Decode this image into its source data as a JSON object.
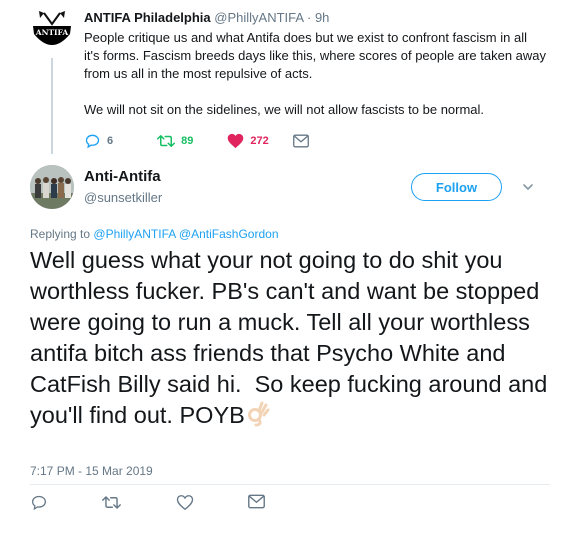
{
  "parent_tweet": {
    "author_name": "ANTIFA Philadelphia",
    "handle": "@PhillyANTIFA",
    "separator": "·",
    "time": "9h",
    "avatar_label": "ANTIFA",
    "paragraphs": [
      "People critique us and what Antifa does but we exist to confront fascism in all it's forms. Fascism breeds days like this, where scores of people are taken away from us all in the most repulsive of acts.",
      "We will not sit on the sidelines, we will not allow fascists to be normal."
    ],
    "replies": "6",
    "retweets": "89",
    "likes": "272"
  },
  "main_tweet": {
    "author_name": "Anti-Antifa",
    "handle": "@sunsetkiller",
    "follow_label": "Follow",
    "replying_prefix": "Replying to",
    "replying_to": "@PhillyANTIFA @AntiFashGordon",
    "text": "Well guess what your not going to do shit you worthless fucker. PB's can't and want be stopped were going to run a muck. Tell all your worthless antifa bitch ass friends that Psycho White and CatFish Billy said hi.  So keep fucking around and you'll find out. POYB",
    "timestamp": "7:17 PM - 15 Mar 2019"
  },
  "colors": {
    "accent": "#1da1f2",
    "retweet": "#17bf63",
    "like": "#e0245e",
    "muted": "#657786"
  },
  "icons": [
    "reply-icon",
    "retweet-icon",
    "heart-icon",
    "message-icon",
    "chevron-down-icon",
    "ok-hand-emoji"
  ]
}
